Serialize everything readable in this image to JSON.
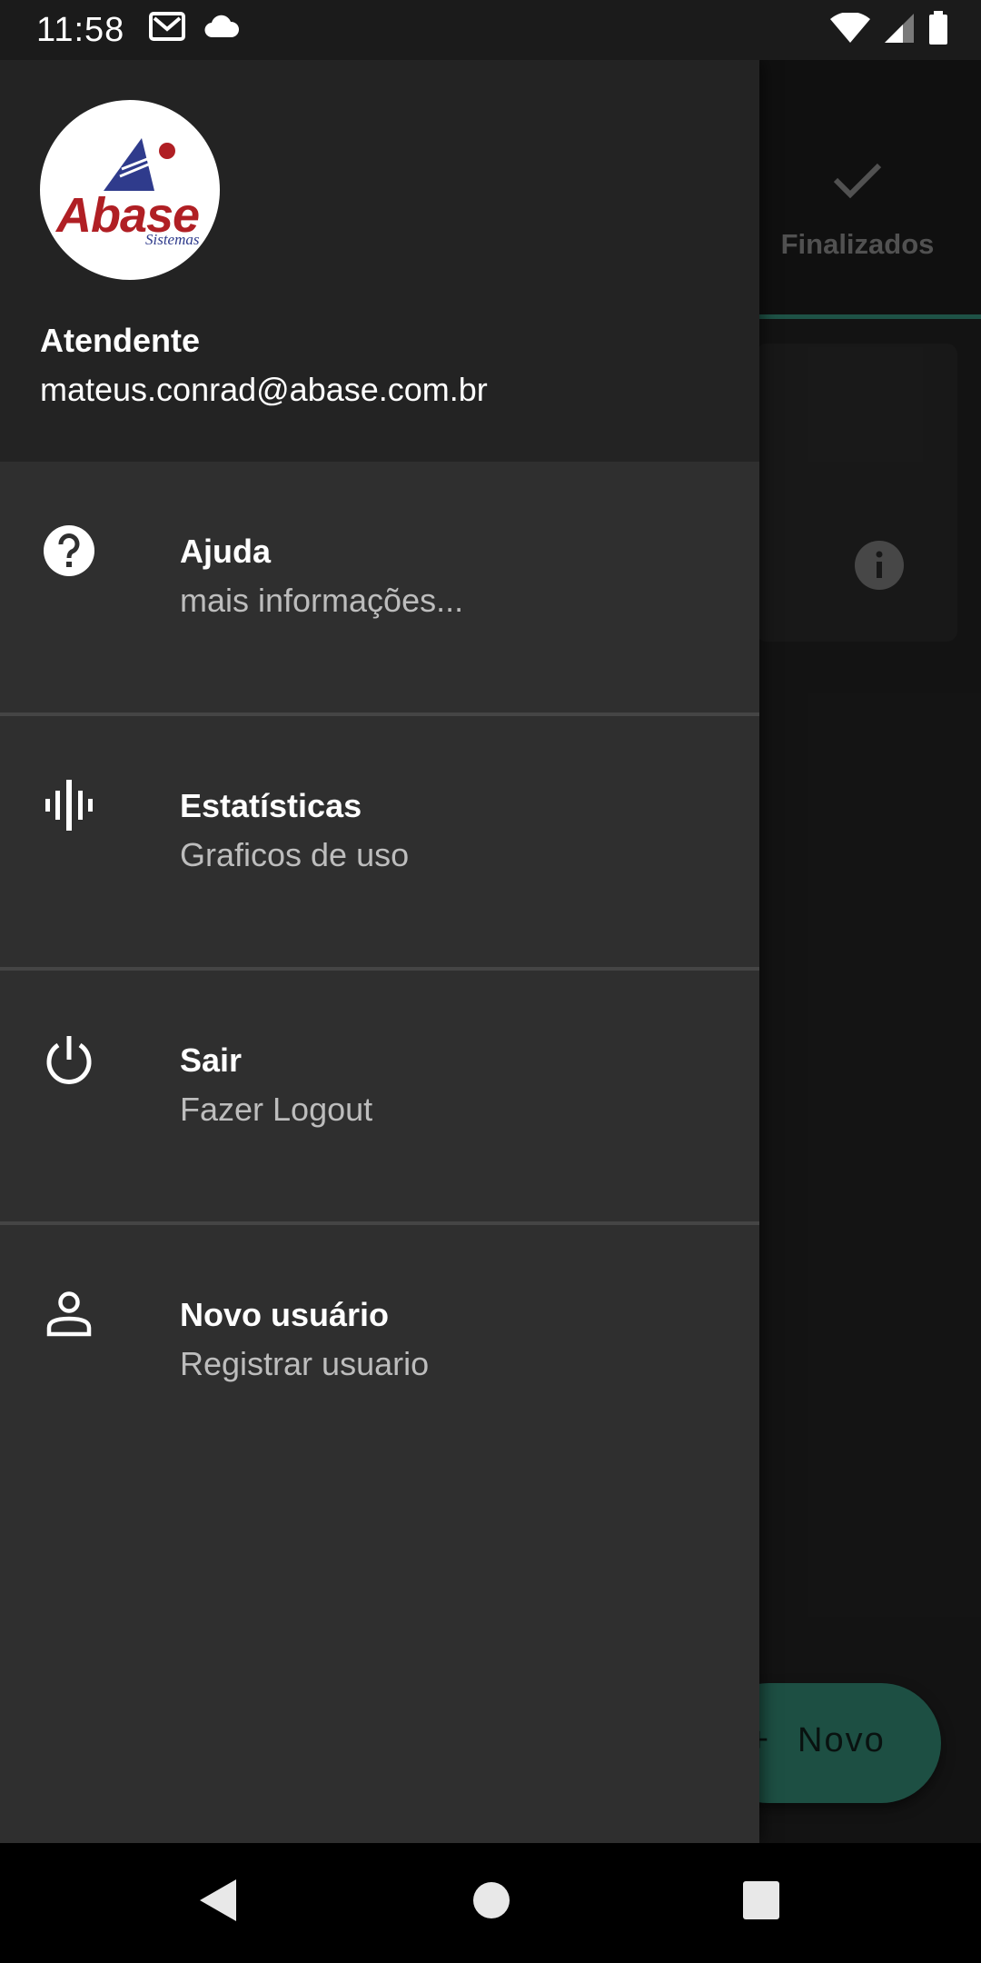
{
  "status_bar": {
    "time": "11:58",
    "left_icons": [
      "gmail-icon",
      "cloud-icon"
    ],
    "right_icons": [
      "wifi-icon",
      "signal-icon",
      "battery-icon"
    ]
  },
  "background_app": {
    "tab_label": "Finalizados",
    "tab_icon": "check-icon",
    "fab_label": "Novo",
    "accent_color": "#2d7a68"
  },
  "drawer": {
    "header": {
      "logo_text": "Abase",
      "logo_subtext": "Sistemas",
      "role": "Atendente",
      "email": "mateus.conrad@abase.com.br"
    },
    "items": [
      {
        "icon": "help-icon",
        "title": "Ajuda",
        "subtitle": "mais informações..."
      },
      {
        "icon": "stats-icon",
        "title": "Estatísticas",
        "subtitle": "Graficos de uso"
      },
      {
        "icon": "power-icon",
        "title": "Sair",
        "subtitle": "Fazer Logout"
      },
      {
        "icon": "person-icon",
        "title": "Novo usuário",
        "subtitle": "Registrar usuario"
      }
    ]
  },
  "nav_bar": {
    "buttons": [
      "back-icon",
      "home-icon",
      "recents-icon"
    ]
  }
}
